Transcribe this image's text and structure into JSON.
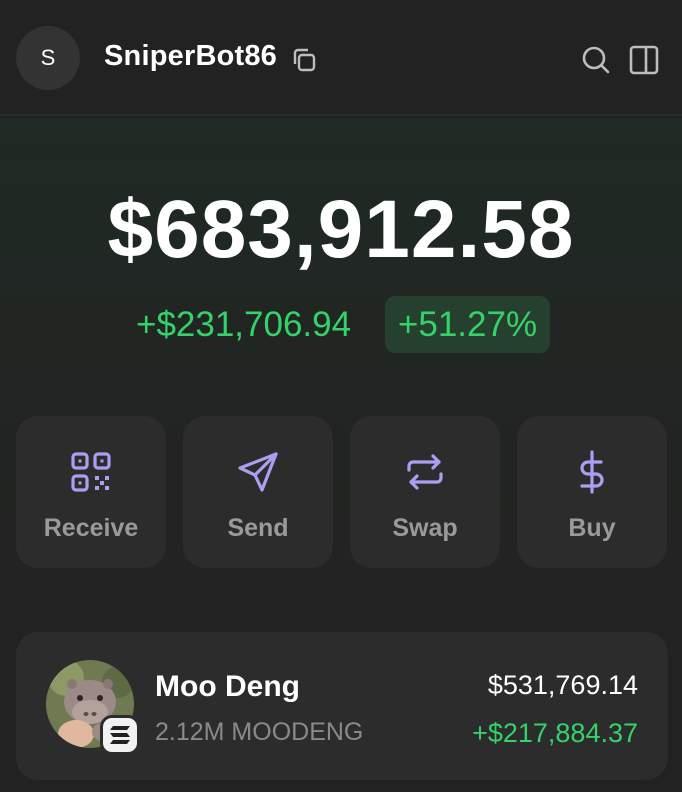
{
  "account": {
    "avatar_initial": "S",
    "name": "SniperBot86"
  },
  "icons": {
    "copy": "copy-icon",
    "search": "search-icon",
    "panel": "sidebar-panel-icon",
    "receive": "qr-code-icon",
    "send": "paper-plane-icon",
    "swap": "swap-arrows-icon",
    "buy": "dollar-icon",
    "chain": "solana-icon"
  },
  "balance": {
    "total": "$683,912.58",
    "change_amount": "+$231,706.94",
    "change_percent": "+51.27%"
  },
  "actions": [
    {
      "label": "Receive"
    },
    {
      "label": "Send"
    },
    {
      "label": "Swap"
    },
    {
      "label": "Buy"
    }
  ],
  "tokens": [
    {
      "name": "Moo Deng",
      "amount": "2.12M MOODENG",
      "value": "$531,769.14",
      "change": "+$217,884.37"
    }
  ],
  "colors": {
    "background": "#222222",
    "card": "#2c2c2c",
    "accent_purple": "#ab9ff2",
    "positive_green": "#34d36a",
    "muted_text": "#9a9a9a"
  }
}
